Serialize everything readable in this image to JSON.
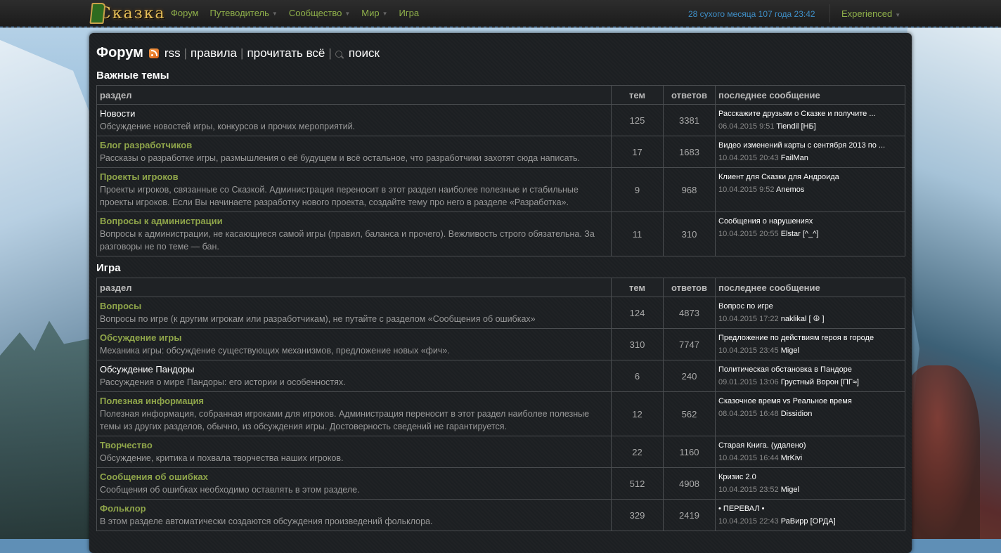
{
  "site": {
    "logo_text": "Сказка"
  },
  "nav": [
    {
      "label": "Форум",
      "dropdown": false
    },
    {
      "label": "Путеводитель",
      "dropdown": true
    },
    {
      "label": "Сообщество",
      "dropdown": true
    },
    {
      "label": "Мир",
      "dropdown": true
    },
    {
      "label": "Игра",
      "dropdown": false
    }
  ],
  "clock": "28 сухого месяца 107 года 23:42",
  "user": {
    "label": "Experienced"
  },
  "header": {
    "title": "Форум",
    "rss": "rss",
    "rules": "правила",
    "read_all": "прочитать всё",
    "search": "поиск",
    "separator": "|"
  },
  "columns": {
    "section": "раздел",
    "topics": "тем",
    "replies": "ответов",
    "last": "последнее сообщение"
  },
  "groups": [
    {
      "title": "Важные темы",
      "rows": [
        {
          "name": "Новости",
          "plain": true,
          "desc": "Обсуждение новостей игры, конкурсов и прочих мероприятий.",
          "topics": "125",
          "replies": "3381",
          "last_title": "Расскажите друзьям о Сказке и получите ...",
          "last_date": "06.04.2015 9:51",
          "last_author": "Tiendil [НБ]"
        },
        {
          "name": "Блог разработчиков",
          "plain": false,
          "desc": "Рассказы о разработке игры, размышления о её будущем и всё остальное, что разработчики захотят сюда написать.",
          "topics": "17",
          "replies": "1683",
          "last_title": "Видео изменений карты с сентября 2013 по ...",
          "last_date": "10.04.2015 20:43",
          "last_author": "FailMan"
        },
        {
          "name": "Проекты игроков",
          "plain": false,
          "desc": "Проекты игроков, связанные со Сказкой. Администрация переносит в этот раздел наиболее полезные и стабильные проекты игроков. Если Вы начинаете разработку нового проекта, создайте тему про него в разделе «Разработка».",
          "topics": "9",
          "replies": "968",
          "last_title": "Клиент для Сказки для Андроида",
          "last_date": "10.04.2015 9:52",
          "last_author": "Anemos"
        },
        {
          "name": "Вопросы к администрации",
          "plain": false,
          "desc": "Вопросы к администрации, не касающиеся самой игры (правил, баланса и прочего). Вежливость строго обязательна. За разговоры не по теме — бан.",
          "topics": "11",
          "replies": "310",
          "last_title": "Сообщения о нарушениях",
          "last_date": "10.04.2015 20:55",
          "last_author": "Elstar [^_^]"
        }
      ]
    },
    {
      "title": "Игра",
      "rows": [
        {
          "name": "Вопросы",
          "plain": false,
          "desc": "Вопросы по игре (к другим игрокам или разработчикам), не путайте с разделом «Сообщения об ошибках»",
          "topics": "124",
          "replies": "4873",
          "last_title": "Вопрос по игре",
          "last_date": "10.04.2015 17:22",
          "last_author": "naklikal [ ☮ ]"
        },
        {
          "name": "Обсуждение игры",
          "plain": false,
          "desc": "Механика игры: обсуждение существующих механизмов, предложение новых «фич».",
          "topics": "310",
          "replies": "7747",
          "last_title": "Предложение по действиям героя в городе",
          "last_date": "10.04.2015 23:45",
          "last_author": "Migel"
        },
        {
          "name": "Обсуждение Пандоры",
          "plain": true,
          "desc": "Рассуждения о мире Пандоры: его истории и особенностях.",
          "topics": "6",
          "replies": "240",
          "last_title": "Политическая обстановка в Пандоре",
          "last_date": "09.01.2015 13:06",
          "last_author": "Грустный Ворон [ПГ≈]"
        },
        {
          "name": "Полезная информация",
          "plain": false,
          "desc": "Полезная информация, собранная игроками для игроков. Администрация переносит в этот раздел наиболее полезные темы из других разделов, обычно, из обсуждения игры. Достоверность сведений не гарантируется.",
          "topics": "12",
          "replies": "562",
          "last_title": "Сказочное время vs Реальное время",
          "last_date": "08.04.2015 16:48",
          "last_author": "Dissidion"
        },
        {
          "name": "Творчество",
          "plain": false,
          "desc": "Обсуждение, критика и похвала творчества наших игроков.",
          "topics": "22",
          "replies": "1160",
          "last_title": "Старая Книга. (удалено)",
          "last_date": "10.04.2015 16:44",
          "last_author": "MrKivi"
        },
        {
          "name": "Сообщения об ошибках",
          "plain": false,
          "desc": "Сообщения об ошибках необходимо оставлять в этом разделе.",
          "topics": "512",
          "replies": "4908",
          "last_title": "Кризис 2.0",
          "last_date": "10.04.2015 23:52",
          "last_author": "Migel"
        },
        {
          "name": "Фольклор",
          "plain": false,
          "desc": "В этом разделе автоматически создаются обсуждения произведений фольклора.",
          "topics": "329",
          "replies": "2419",
          "last_title": "• ПЕРЕВАЛ •",
          "last_date": "10.04.2015 22:43",
          "last_author": "РаВирр [ОРДА]"
        }
      ]
    }
  ]
}
